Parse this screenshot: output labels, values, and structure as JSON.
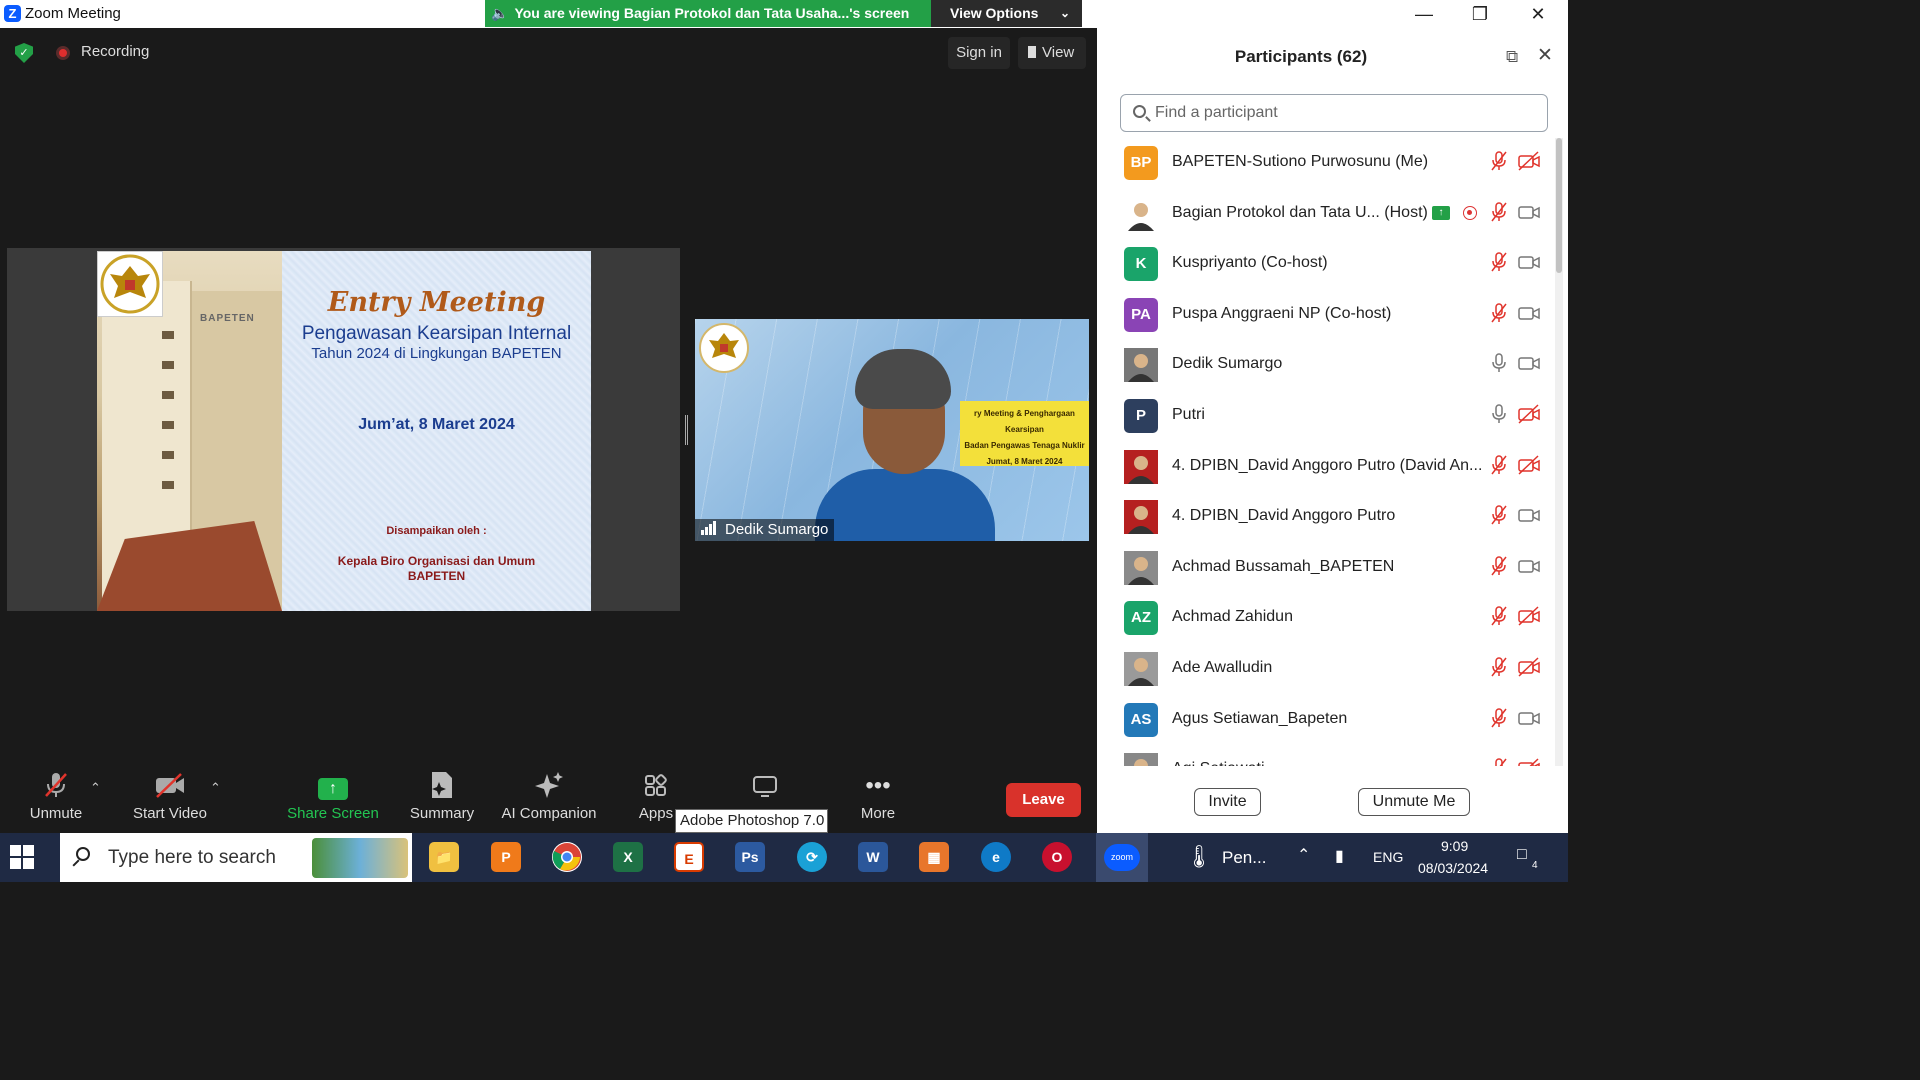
{
  "window": {
    "title": "Zoom Meeting",
    "banner": "You are viewing Bagian Protokol dan Tata Usaha...'s screen",
    "view_options": "View Options"
  },
  "meeting": {
    "recording_label": "Recording",
    "sign_in": "Sign in",
    "view": "View"
  },
  "slide": {
    "title": "Entry Meeting",
    "subtitle1": "Pengawasan Kearsipan Internal",
    "subtitle2": "Tahun 2024 di Lingkungan BAPETEN",
    "date": "Jum’at, 8 Maret 2024",
    "presented_by": "Disampaikan oleh :",
    "presenter1": "Kepala Biro Organisasi dan Umum",
    "presenter2": "BAPETEN",
    "building_sign": "BAPETEN"
  },
  "video": {
    "name": "Dedik Sumargo",
    "banner_line1": "ry Meeting & Penghargaan Kearsipan",
    "banner_line2": "Badan Pengawas Tenaga Nuklir",
    "banner_line3": "Jumat, 8 Maret 2024"
  },
  "controls": {
    "unmute": "Unmute",
    "start_video": "Start Video",
    "share_screen": "Share Screen",
    "summary": "Summary",
    "ai_companion": "AI Companion",
    "apps": "Apps",
    "more": "More",
    "leave": "Leave",
    "tooltip": "Adobe Photoshop 7.0"
  },
  "participants_panel": {
    "title": "Participants (62)",
    "search_placeholder": "Find a participant",
    "invite": "Invite",
    "unmute_me": "Unmute Me",
    "participants": [
      {
        "initials": "BP",
        "color": "#f39a1e",
        "name": "BAPETEN-Sutiono Purwosunu (Me)",
        "mic": "muted",
        "cam": "off"
      },
      {
        "initials": "",
        "color": "#ffffff",
        "name": "Bagian Protokol dan Tata U...  (Host)",
        "mic": "muted",
        "cam": "on",
        "sharing": true,
        "recording": true
      },
      {
        "initials": "K",
        "color": "#1aa46a",
        "name": "Kuspriyanto (Co-host)",
        "mic": "muted",
        "cam": "on"
      },
      {
        "initials": "PA",
        "color": "#8a44b5",
        "name": "Puspa Anggraeni NP (Co-host)",
        "mic": "muted",
        "cam": "on"
      },
      {
        "initials": "",
        "color": "#777777",
        "name": "Dedik Sumargo",
        "mic": "on",
        "cam": "on"
      },
      {
        "initials": "P",
        "color": "#2d3f5e",
        "name": "Putri",
        "mic": "on",
        "cam": "off"
      },
      {
        "initials": "",
        "color": "#b52020",
        "name": "4. DPIBN_David Anggoro Putro (David An...",
        "mic": "muted",
        "cam": "off"
      },
      {
        "initials": "",
        "color": "#b52020",
        "name": "4. DPIBN_David Anggoro Putro",
        "mic": "muted",
        "cam": "on"
      },
      {
        "initials": "",
        "color": "#8a8a8a",
        "name": "Achmad Bussamah_BAPETEN",
        "mic": "muted",
        "cam": "on"
      },
      {
        "initials": "AZ",
        "color": "#1aa46a",
        "name": "Achmad Zahidun",
        "mic": "muted",
        "cam": "off"
      },
      {
        "initials": "",
        "color": "#9a9a9a",
        "name": "Ade Awalludin",
        "mic": "muted",
        "cam": "off"
      },
      {
        "initials": "AS",
        "color": "#2379b8",
        "name": "Agus Setiawan_Bapeten",
        "mic": "muted",
        "cam": "on"
      },
      {
        "initials": "",
        "color": "#888888",
        "name": "Agi Setiawati",
        "mic": "muted",
        "cam": "off"
      }
    ]
  },
  "taskbar": {
    "search_text": "Type here to search",
    "weather": "Pen...",
    "lang": "ENG",
    "time": "9:09",
    "date": "08/03/2024",
    "notif_count": "4"
  },
  "colors": {
    "banner_green": "#23a047",
    "leave_red": "#d9322b",
    "share_green": "#22b14c",
    "muted_red": "#e0342c"
  }
}
